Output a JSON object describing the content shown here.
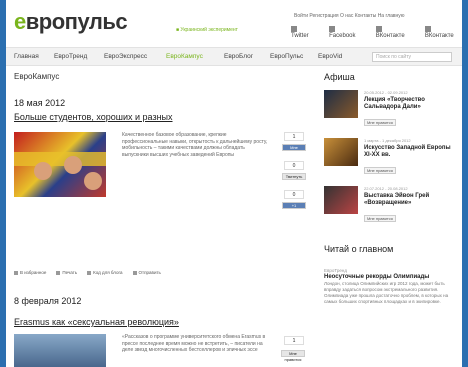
{
  "logo": {
    "e": "е",
    "rest": "вропульс"
  },
  "tagline": "■ Украинский эксперимент",
  "toplinks": "Войти  Регистрация  О нас  Контакты  На главную",
  "social": [
    {
      "icon": "twitter-icon",
      "label": "Twitter"
    },
    {
      "icon": "facebook-icon",
      "label": "Facebook"
    },
    {
      "icon": "vkontakte-icon",
      "label": "ВКонтакте"
    },
    {
      "icon": "email-icon",
      "label": "ВКонтакте"
    }
  ],
  "nav": {
    "items": [
      {
        "label": "Главная",
        "active": false
      },
      {
        "label": "ЕвроТренд",
        "active": false
      },
      {
        "label": "ЕвроЭкспресс",
        "active": false
      },
      {
        "label": "ЕвроКампус",
        "active": true
      },
      {
        "label": "ЕвроБлог",
        "active": false
      },
      {
        "label": "ЕвроПульс",
        "active": false
      },
      {
        "label": "ЕвроVid",
        "active": false
      }
    ],
    "search_placeholder": "Поиск по сайту"
  },
  "main": {
    "section_title": "ЕвроКампус",
    "article1": {
      "date": "18 мая 2012",
      "headline": "Больше студентов, хороших и разных",
      "excerpt": "Качественное базовое образование, крепкие профессиональные навыки, открытость к дальнейшему росту, мобильность – такими качествами должны обладать выпускники высших учебных заведений Европы",
      "share_count_top": "1",
      "share_like": "Мне нравится",
      "share_zero": "0",
      "share_tweet": "Твитнуть",
      "share_plus": "+1",
      "share_bottom": "0"
    },
    "actions": [
      "В избранное",
      "Печать",
      "Код для блога",
      "Отправить"
    ],
    "article2": {
      "date": "8 февраля 2012",
      "headline": "Erasmus как «сексуальная революция»",
      "excerpt": "«Рассказов о программе университетского обмена Erasmus в прессе последнее время можно не встретить, – писатели на деле звезд многочисленных бестселлеров и эпичных эссе",
      "share_count": "1",
      "share_like": "Мне нравится"
    }
  },
  "side": {
    "afisha_title": "Афиша",
    "events": [
      {
        "meta": "20.05.2012 - 02.09.2012",
        "title": "Лекция «Творчество Сальвадора Дали»",
        "btn": "Мне нравится"
      },
      {
        "meta": "1 марта - 1 декабря 2012",
        "title": "Искусство Западной Европы XI-XX вв.",
        "btn": "Мне нравится"
      },
      {
        "meta": "22.07.2012 - 20.08.2012",
        "title": "Выставка Эйвон Грей «Возвращение»",
        "btn": "Мне нравится"
      }
    ],
    "read_title": "Читай о главном",
    "read_meta": "ЕвроТренд",
    "read_headline": "Неосуточные рекорды Олимпиады",
    "read_body": "Лондон, столица Олимпийских игр 2012 года, может быть вправду задаться вопросом экстремального развития. Олимпиада уже прошла достаточно проблем, в которых на самых больших спортивных площадках и в экипировке.",
    "colors": {
      "accent": "#7ab51d",
      "link": "#222222"
    }
  }
}
